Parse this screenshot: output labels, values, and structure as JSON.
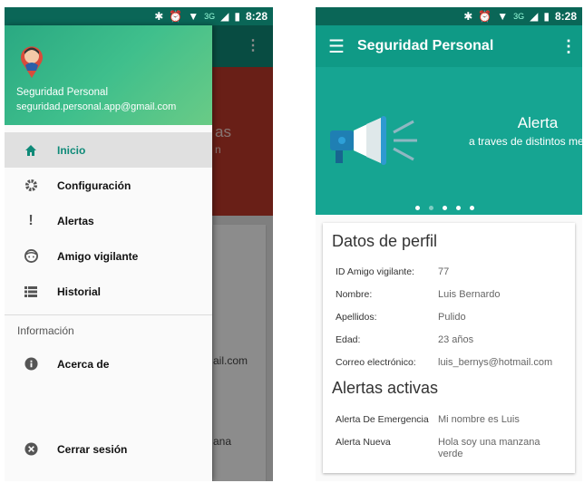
{
  "status_bar": {
    "time": "8:28",
    "network": "3G"
  },
  "left_screen": {
    "background_fragments": [
      "as",
      "n",
      "ail.com",
      "ana"
    ],
    "drawer": {
      "user_name": "Seguridad Personal",
      "user_email": "seguridad.personal.app@gmail.com",
      "items": [
        {
          "label": "Inicio",
          "icon": "home-icon",
          "active": true
        },
        {
          "label": "Configuración",
          "icon": "gear-icon",
          "active": false
        },
        {
          "label": "Alertas",
          "icon": "exclamation-icon",
          "active": false
        },
        {
          "label": "Amigo vigilante",
          "icon": "face-icon",
          "active": false
        },
        {
          "label": "Historial",
          "icon": "list-icon",
          "active": false
        }
      ],
      "section_label": "Información",
      "about_label": "Acerca de",
      "logout_label": "Cerrar sesión"
    }
  },
  "right_screen": {
    "toolbar_title": "Seguridad Personal",
    "carousel": {
      "title": "Alerta",
      "subtitle": "a traves de distintos medios.",
      "page_count": 5,
      "active_page": 2
    },
    "profile": {
      "title": "Datos de perfil",
      "rows": [
        {
          "label": "ID Amigo vigilante:",
          "value": "77"
        },
        {
          "label": "Nombre:",
          "value": "Luis Bernardo"
        },
        {
          "label": "Apellidos:",
          "value": "Pulido"
        },
        {
          "label": "Edad:",
          "value": "23 años"
        },
        {
          "label": "Correo electrónico:",
          "value": "luis_bernys@hotmail.com"
        }
      ]
    },
    "alerts": {
      "title": "Alertas activas",
      "rows": [
        {
          "label": "Alerta De Emergencia",
          "value": "Mi nombre es Luis"
        },
        {
          "label": "Alerta Nueva",
          "value": "Hola soy una manzana verde"
        }
      ]
    }
  },
  "colors": {
    "primary": "#0f9a86",
    "primary_dark": "#0a6657",
    "banner_bg": "#16a592"
  }
}
